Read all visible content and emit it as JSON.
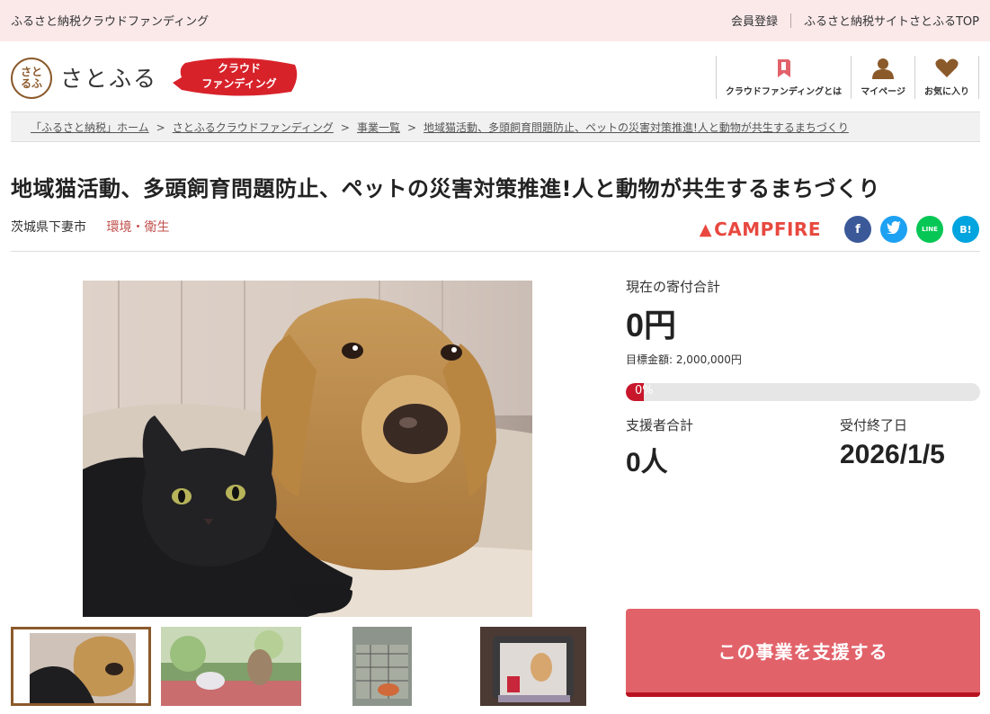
{
  "topbar": {
    "site_name": "ふるさと納税クラウドファンディング",
    "links": [
      "会員登録",
      "ふるさと納税サイトさとふるTOP"
    ]
  },
  "header": {
    "logo_mark": "さと\nるふ",
    "logo_text": "さとふる",
    "badge_line1": "クラウド",
    "badge_line2": "ファンディング",
    "nav": [
      {
        "label": "クラウドファンディングとは",
        "icon": "bookmark-icon"
      },
      {
        "label": "マイページ",
        "icon": "user-icon"
      },
      {
        "label": "お気に入り",
        "icon": "heart-icon"
      }
    ]
  },
  "breadcrumb": [
    "「ふるさと納税」ホーム",
    "さとふるクラウドファンディング",
    "事業一覧",
    "地域猫活動、多頭飼育問題防止、ペットの災害対策推進!人と動物が共生するまちづくり"
  ],
  "project": {
    "title": "地域猫活動、多頭飼育問題防止、ペットの災害対策推進!人と動物が共生するまちづくり",
    "prefecture": "茨城県下妻市",
    "category": "環境・衛生"
  },
  "share": {
    "campfire": "CAMPFIRE",
    "buttons": [
      {
        "name": "facebook",
        "glyph": "f",
        "color": "#3b5998"
      },
      {
        "name": "twitter",
        "glyph": "t",
        "color": "#1da1f2"
      },
      {
        "name": "line",
        "glyph": "LINE",
        "color": "#06c755"
      },
      {
        "name": "hatena",
        "glyph": "B!",
        "color": "#00a4de"
      }
    ]
  },
  "stats": {
    "current_label": "現在の寄付合計",
    "current_amount": "0円",
    "goal_text": "目標金額: 2,000,000円",
    "progress_label": "0%",
    "progress_value": 0,
    "supporters_label": "支援者合計",
    "supporters": "0人",
    "deadline_label": "受付終了日",
    "deadline": "2026/1/5"
  },
  "support_button": "この事業を支援する",
  "colors": {
    "accent": "#e2626a",
    "progress": "#c8162b",
    "topbar": "#fbe9ea",
    "category": "#c0504d"
  }
}
